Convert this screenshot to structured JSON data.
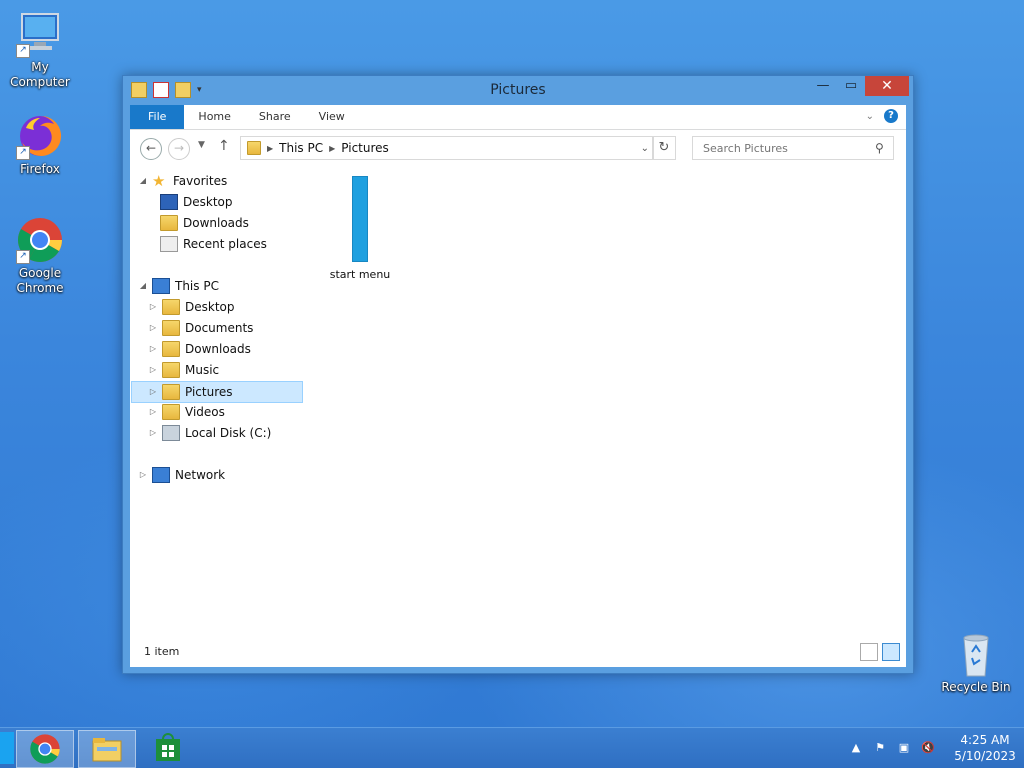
{
  "desktop": {
    "icons": {
      "my_computer": "My Computer",
      "firefox": "Firefox",
      "chrome": "Google Chrome",
      "recycle_bin": "Recycle Bin"
    }
  },
  "window": {
    "title": "Pictures",
    "ribbon_tabs": {
      "file": "File",
      "home": "Home",
      "share": "Share",
      "view": "View"
    },
    "breadcrumb": {
      "this_pc": "This PC",
      "pictures": "Pictures"
    },
    "search_placeholder": "Search Pictures",
    "nav_pane": {
      "favorites": "Favorites",
      "fav_desktop": "Desktop",
      "fav_downloads": "Downloads",
      "fav_recent": "Recent places",
      "this_pc": "This PC",
      "pc_desktop": "Desktop",
      "pc_documents": "Documents",
      "pc_downloads": "Downloads",
      "pc_music": "Music",
      "pc_pictures": "Pictures",
      "pc_videos": "Videos",
      "pc_local_disk": "Local Disk (C:)",
      "network": "Network"
    },
    "files": {
      "item1": "start menu"
    },
    "status": "1 item"
  },
  "taskbar": {
    "time": "4:25 AM",
    "date": "5/10/2023"
  },
  "colors": {
    "accent": "#1979ca",
    "selection": "#cce8ff",
    "close_button": "#c7453a",
    "taskbar": "#2f6fc2"
  }
}
